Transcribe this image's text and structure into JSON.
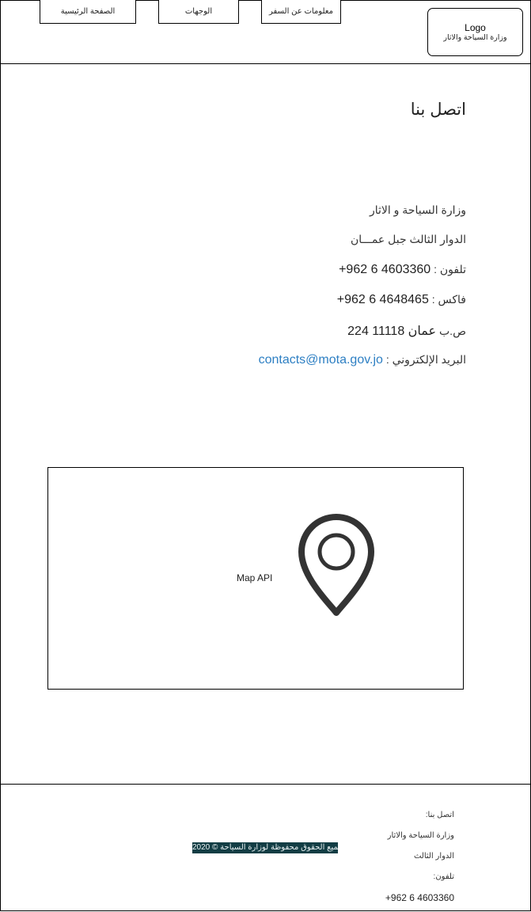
{
  "header": {
    "nav": {
      "home": "الصفحة الرئيسية",
      "destinations": "الوجهات",
      "travel_info": "معلومات عن السفر"
    },
    "logo": {
      "title": "Logo",
      "subtitle": "وزارة السياحة والاثار"
    }
  },
  "contact": {
    "title": "اتصل بنا",
    "ministry": "وزارة السياحة و الاثار",
    "address": "الدوار الثالث جبل عمـــان",
    "phone_label": "تلفون :",
    "phone_value": "+962 6 4603360",
    "fax_label": "فاكس :",
    "fax_value": "+962 6 4648465",
    "pobox_label": "ص.ب",
    "pobox_value": "224 عمان 11118",
    "email_label": "البريد الإلكتروني :",
    "email_value": "contacts@mota.gov.jo"
  },
  "map": {
    "label": "Map API",
    "icon": "map-pin-icon"
  },
  "footer": {
    "contact_heading": "اتصل بنا:",
    "ministry": "وزارة السياحة والاثار",
    "address": "الدوار الثالث",
    "phone_label": "تلفون:",
    "phone_value": "+962 6 4603360",
    "copyright": "جميع الحقوق محفوظة لوزارة السياحة © 2020"
  }
}
